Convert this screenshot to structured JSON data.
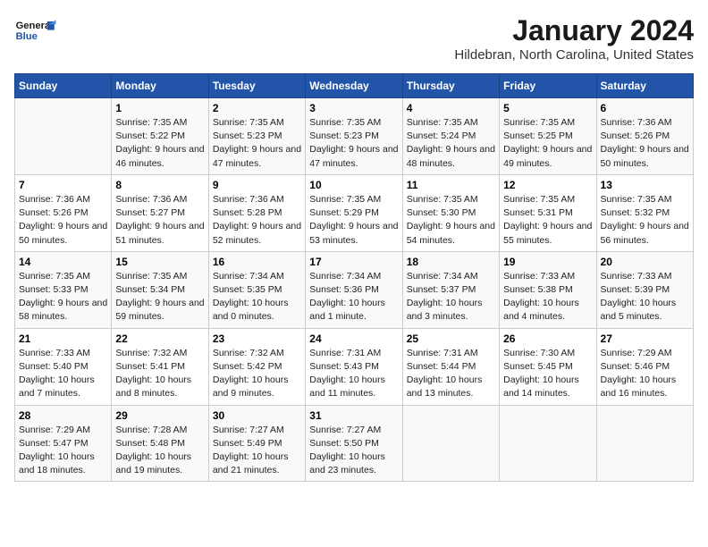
{
  "header": {
    "logo_general": "General",
    "logo_blue": "Blue",
    "title": "January 2024",
    "subtitle": "Hildebran, North Carolina, United States"
  },
  "days_of_week": [
    "Sunday",
    "Monday",
    "Tuesday",
    "Wednesday",
    "Thursday",
    "Friday",
    "Saturday"
  ],
  "weeks": [
    [
      {
        "day": "",
        "sunrise": "",
        "sunset": "",
        "daylight": ""
      },
      {
        "day": "1",
        "sunrise": "Sunrise: 7:35 AM",
        "sunset": "Sunset: 5:22 PM",
        "daylight": "Daylight: 9 hours and 46 minutes."
      },
      {
        "day": "2",
        "sunrise": "Sunrise: 7:35 AM",
        "sunset": "Sunset: 5:23 PM",
        "daylight": "Daylight: 9 hours and 47 minutes."
      },
      {
        "day": "3",
        "sunrise": "Sunrise: 7:35 AM",
        "sunset": "Sunset: 5:23 PM",
        "daylight": "Daylight: 9 hours and 47 minutes."
      },
      {
        "day": "4",
        "sunrise": "Sunrise: 7:35 AM",
        "sunset": "Sunset: 5:24 PM",
        "daylight": "Daylight: 9 hours and 48 minutes."
      },
      {
        "day": "5",
        "sunrise": "Sunrise: 7:35 AM",
        "sunset": "Sunset: 5:25 PM",
        "daylight": "Daylight: 9 hours and 49 minutes."
      },
      {
        "day": "6",
        "sunrise": "Sunrise: 7:36 AM",
        "sunset": "Sunset: 5:26 PM",
        "daylight": "Daylight: 9 hours and 50 minutes."
      }
    ],
    [
      {
        "day": "7",
        "sunrise": "Sunrise: 7:36 AM",
        "sunset": "Sunset: 5:26 PM",
        "daylight": "Daylight: 9 hours and 50 minutes."
      },
      {
        "day": "8",
        "sunrise": "Sunrise: 7:36 AM",
        "sunset": "Sunset: 5:27 PM",
        "daylight": "Daylight: 9 hours and 51 minutes."
      },
      {
        "day": "9",
        "sunrise": "Sunrise: 7:36 AM",
        "sunset": "Sunset: 5:28 PM",
        "daylight": "Daylight: 9 hours and 52 minutes."
      },
      {
        "day": "10",
        "sunrise": "Sunrise: 7:35 AM",
        "sunset": "Sunset: 5:29 PM",
        "daylight": "Daylight: 9 hours and 53 minutes."
      },
      {
        "day": "11",
        "sunrise": "Sunrise: 7:35 AM",
        "sunset": "Sunset: 5:30 PM",
        "daylight": "Daylight: 9 hours and 54 minutes."
      },
      {
        "day": "12",
        "sunrise": "Sunrise: 7:35 AM",
        "sunset": "Sunset: 5:31 PM",
        "daylight": "Daylight: 9 hours and 55 minutes."
      },
      {
        "day": "13",
        "sunrise": "Sunrise: 7:35 AM",
        "sunset": "Sunset: 5:32 PM",
        "daylight": "Daylight: 9 hours and 56 minutes."
      }
    ],
    [
      {
        "day": "14",
        "sunrise": "Sunrise: 7:35 AM",
        "sunset": "Sunset: 5:33 PM",
        "daylight": "Daylight: 9 hours and 58 minutes."
      },
      {
        "day": "15",
        "sunrise": "Sunrise: 7:35 AM",
        "sunset": "Sunset: 5:34 PM",
        "daylight": "Daylight: 9 hours and 59 minutes."
      },
      {
        "day": "16",
        "sunrise": "Sunrise: 7:34 AM",
        "sunset": "Sunset: 5:35 PM",
        "daylight": "Daylight: 10 hours and 0 minutes."
      },
      {
        "day": "17",
        "sunrise": "Sunrise: 7:34 AM",
        "sunset": "Sunset: 5:36 PM",
        "daylight": "Daylight: 10 hours and 1 minute."
      },
      {
        "day": "18",
        "sunrise": "Sunrise: 7:34 AM",
        "sunset": "Sunset: 5:37 PM",
        "daylight": "Daylight: 10 hours and 3 minutes."
      },
      {
        "day": "19",
        "sunrise": "Sunrise: 7:33 AM",
        "sunset": "Sunset: 5:38 PM",
        "daylight": "Daylight: 10 hours and 4 minutes."
      },
      {
        "day": "20",
        "sunrise": "Sunrise: 7:33 AM",
        "sunset": "Sunset: 5:39 PM",
        "daylight": "Daylight: 10 hours and 5 minutes."
      }
    ],
    [
      {
        "day": "21",
        "sunrise": "Sunrise: 7:33 AM",
        "sunset": "Sunset: 5:40 PM",
        "daylight": "Daylight: 10 hours and 7 minutes."
      },
      {
        "day": "22",
        "sunrise": "Sunrise: 7:32 AM",
        "sunset": "Sunset: 5:41 PM",
        "daylight": "Daylight: 10 hours and 8 minutes."
      },
      {
        "day": "23",
        "sunrise": "Sunrise: 7:32 AM",
        "sunset": "Sunset: 5:42 PM",
        "daylight": "Daylight: 10 hours and 9 minutes."
      },
      {
        "day": "24",
        "sunrise": "Sunrise: 7:31 AM",
        "sunset": "Sunset: 5:43 PM",
        "daylight": "Daylight: 10 hours and 11 minutes."
      },
      {
        "day": "25",
        "sunrise": "Sunrise: 7:31 AM",
        "sunset": "Sunset: 5:44 PM",
        "daylight": "Daylight: 10 hours and 13 minutes."
      },
      {
        "day": "26",
        "sunrise": "Sunrise: 7:30 AM",
        "sunset": "Sunset: 5:45 PM",
        "daylight": "Daylight: 10 hours and 14 minutes."
      },
      {
        "day": "27",
        "sunrise": "Sunrise: 7:29 AM",
        "sunset": "Sunset: 5:46 PM",
        "daylight": "Daylight: 10 hours and 16 minutes."
      }
    ],
    [
      {
        "day": "28",
        "sunrise": "Sunrise: 7:29 AM",
        "sunset": "Sunset: 5:47 PM",
        "daylight": "Daylight: 10 hours and 18 minutes."
      },
      {
        "day": "29",
        "sunrise": "Sunrise: 7:28 AM",
        "sunset": "Sunset: 5:48 PM",
        "daylight": "Daylight: 10 hours and 19 minutes."
      },
      {
        "day": "30",
        "sunrise": "Sunrise: 7:27 AM",
        "sunset": "Sunset: 5:49 PM",
        "daylight": "Daylight: 10 hours and 21 minutes."
      },
      {
        "day": "31",
        "sunrise": "Sunrise: 7:27 AM",
        "sunset": "Sunset: 5:50 PM",
        "daylight": "Daylight: 10 hours and 23 minutes."
      },
      {
        "day": "",
        "sunrise": "",
        "sunset": "",
        "daylight": ""
      },
      {
        "day": "",
        "sunrise": "",
        "sunset": "",
        "daylight": ""
      },
      {
        "day": "",
        "sunrise": "",
        "sunset": "",
        "daylight": ""
      }
    ]
  ]
}
